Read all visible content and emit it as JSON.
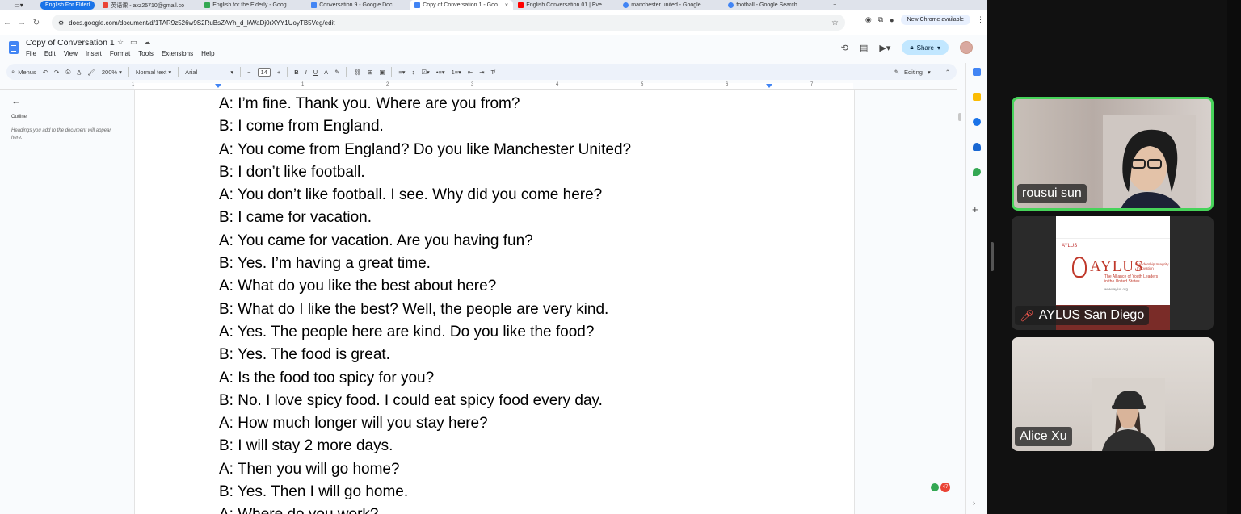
{
  "tabs": [
    {
      "title": "English For Elderl",
      "color": "#1a73e8"
    },
    {
      "title": "英语课 - axz25710@gmail.co",
      "color": "#ea4335"
    },
    {
      "title": "English for the Elderly - Goog",
      "color": "#34a853"
    },
    {
      "title": "Conversation 9 - Google Doc",
      "color": "#4285f4"
    },
    {
      "title": "Copy of Conversation 1 - Goo",
      "color": "#4285f4"
    },
    {
      "title": "English Conversation 01 | Eve",
      "color": "#ff0000"
    },
    {
      "title": "manchester united - Google",
      "color": "#4285f4"
    },
    {
      "title": "football - Google Search",
      "color": "#4285f4"
    }
  ],
  "url": "docs.google.com/document/d/1TAR9z526w9S2RuBsZAYh_d_kWaDj0rXYY1UoyTB5Veg/edit",
  "new_chrome": "New Chrome available",
  "doc": {
    "title": "Copy of Conversation 1",
    "menu": [
      "File",
      "Edit",
      "View",
      "Insert",
      "Format",
      "Tools",
      "Extensions",
      "Help"
    ],
    "share": "Share",
    "editing": "Editing"
  },
  "toolbar": {
    "menus": "Menus",
    "zoom": "200%",
    "style": "Normal text",
    "font": "Arial",
    "size": "14"
  },
  "ruler_numbers": [
    "1",
    "1",
    "2",
    "3",
    "4",
    "5",
    "6",
    "7"
  ],
  "outline": {
    "title": "Outline",
    "hint": "Headings you add to the document will appear here."
  },
  "lines": [
    "A: I’m fine. Thank you. Where are you from?",
    "B: I come from England.",
    "A: You come from England? Do you like Manchester United?",
    "B: I don’t like football.",
    "A: You don’t like football. I see. Why did you come here?",
    "B: I came for vacation.",
    "A: You came for vacation. Are you having fun?",
    "B: Yes. I’m having a great time.",
    "A: What do you like the best about here?",
    "B: What do I like the best? Well, the people are very kind.",
    "A: Yes. The people here are kind. Do you like the food?",
    "B: Yes. The food is great.",
    "A: Is the food too spicy for you?",
    "B: No. I love spicy food. I could eat spicy food every day.",
    "A: How much longer will you stay here?",
    "B: I will stay 2 more days.",
    "A: Then you will go home?",
    "B: Yes. Then I will go home.",
    "A: Where do you work?"
  ],
  "badge_count": "47",
  "participants": [
    {
      "name": "rousui sun"
    },
    {
      "name": "AYLUS San Diego"
    },
    {
      "name": "Alice Xu"
    }
  ],
  "aylus": {
    "small": "AYLUS",
    "logo": "AYLUS",
    "sub": "Leadership Integrity Innovation",
    "full": "The Alliance of Youth Leaders in the United States",
    "url": "www.aylus.org"
  }
}
